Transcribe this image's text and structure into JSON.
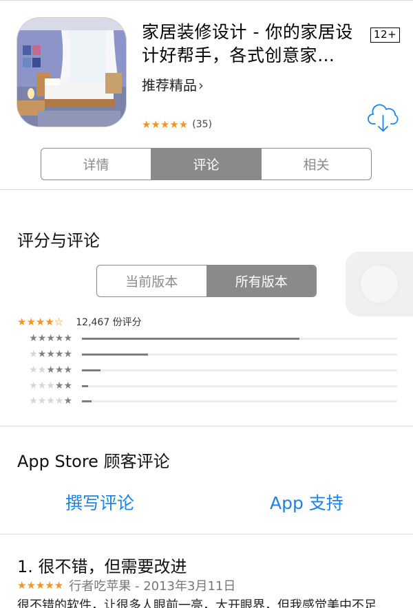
{
  "app": {
    "title": "家居装修设计 - 你的家居设计好帮手，各式创意家…",
    "age_rating": "12+",
    "developer_link": "推荐精品",
    "stars": "★★★★★",
    "rating_count": "(35)"
  },
  "tabs": [
    {
      "label": "详情",
      "active": false
    },
    {
      "label": "评论",
      "active": true
    },
    {
      "label": "相关",
      "active": false
    }
  ],
  "ratings": {
    "section_title": "评分与评论",
    "version_tabs": [
      {
        "label": "当前版本",
        "active": false
      },
      {
        "label": "所有版本",
        "active": true
      }
    ],
    "overall_stars": "★★★★☆",
    "total": "12,467 份评分",
    "histogram": [
      {
        "stars": 5,
        "fraction": 0.69
      },
      {
        "stars": 4,
        "fraction": 0.21
      },
      {
        "stars": 3,
        "fraction": 0.06
      },
      {
        "stars": 2,
        "fraction": 0.02
      },
      {
        "stars": 1,
        "fraction": 0.03
      }
    ]
  },
  "reviews": {
    "section_title": "App Store 顾客评论",
    "write_label": "撰写评论",
    "support_label": "App 支持",
    "items": [
      {
        "title": "1. 很不错，但需要改进",
        "stars": "★★★★★",
        "meta": "行者吃苹果 - 2013年3月11日",
        "body": "很不错的软件，让很多人眼前一亮，大开眼界，但我感觉美中不足"
      }
    ]
  },
  "colors": {
    "accent": "#1a82e8",
    "star": "#f7931e",
    "segment": "#8a8a8a"
  }
}
